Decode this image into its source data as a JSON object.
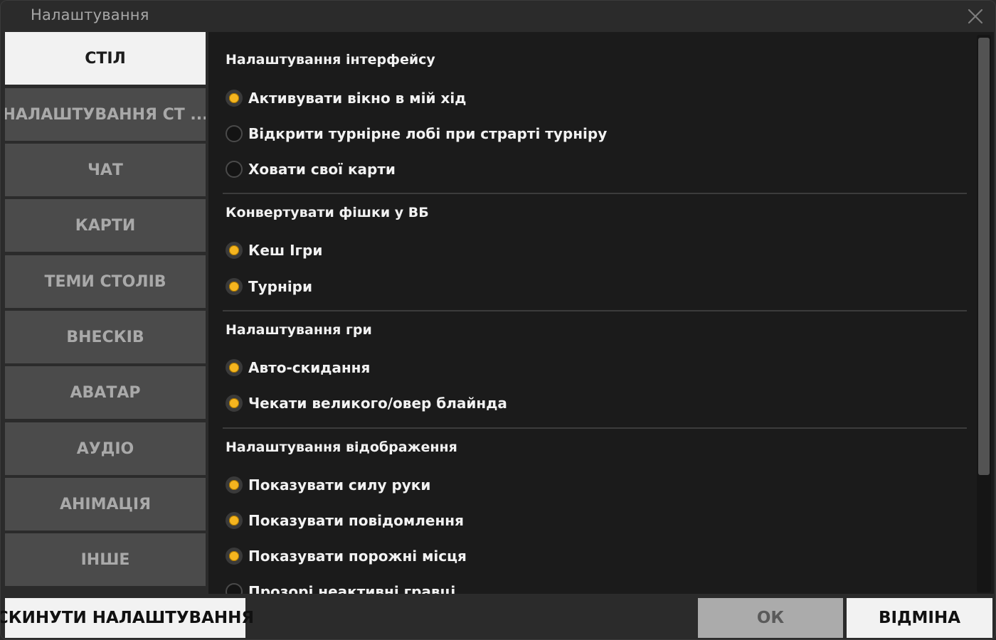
{
  "window": {
    "title": "Налаштування"
  },
  "sidebar": {
    "items": [
      {
        "label": "СТІЛ",
        "active": true
      },
      {
        "label": "НАЛАШТУВАННЯ СТ ...",
        "active": false
      },
      {
        "label": "ЧАТ",
        "active": false
      },
      {
        "label": "КАРТИ",
        "active": false
      },
      {
        "label": "ТЕМИ СТОЛІВ",
        "active": false
      },
      {
        "label": "ВНЕСКІВ",
        "active": false
      },
      {
        "label": "АВАТАР",
        "active": false
      },
      {
        "label": "АУДІО",
        "active": false
      },
      {
        "label": "АНІМАЦІЯ",
        "active": false
      },
      {
        "label": "ІНШЕ",
        "active": false
      }
    ]
  },
  "sections": [
    {
      "title": "Налаштування інтерфейсу",
      "options": [
        {
          "label": "Активувати вікно в мій хід",
          "checked": true
        },
        {
          "label": "Відкрити турнірне лобі при страрті турніру",
          "checked": false
        },
        {
          "label": "Ховати свої карти",
          "checked": false
        }
      ]
    },
    {
      "title": "Конвертувати фішки у ВБ",
      "options": [
        {
          "label": "Кеш Ігри",
          "checked": true
        },
        {
          "label": "Турніри",
          "checked": true
        }
      ]
    },
    {
      "title": "Налаштування гри",
      "options": [
        {
          "label": "Авто-скидання",
          "checked": true
        },
        {
          "label": "Чекати великого/овер блайнда",
          "checked": true
        }
      ]
    },
    {
      "title": "Налаштування відображення",
      "options": [
        {
          "label": "Показувати силу руки",
          "checked": true
        },
        {
          "label": "Показувати повідомлення",
          "checked": true
        },
        {
          "label": "Показувати порожні місця",
          "checked": true
        },
        {
          "label": "Прозорі неактивні гравці",
          "checked": false
        }
      ]
    }
  ],
  "footer": {
    "reset_label": "СКИНУТИ НАЛАШТУВАННЯ",
    "ok_label": "ОК",
    "cancel_label": "ВІДМІНА"
  },
  "colors": {
    "accent_radio": "#f5b51f",
    "panel_bg": "#1b1b1b",
    "sidebar_item_bg": "#4b4b4b",
    "active_item_bg": "#f2f2f2"
  }
}
